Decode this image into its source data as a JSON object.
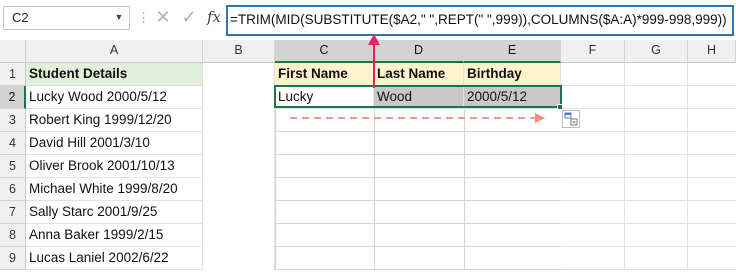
{
  "formula_bar": {
    "name_box": "C2",
    "cancel_icon": "✕",
    "enter_icon": "✓",
    "fx_label": "fx",
    "formula": "=TRIM(MID(SUBSTITUTE($A2,\" \",REPT(\" \",999)),COLUMNS($A:A)*999-998,999))"
  },
  "columns": [
    "A",
    "B",
    "C",
    "D",
    "E",
    "F",
    "G",
    "H"
  ],
  "rows": [
    "1",
    "2",
    "3",
    "4",
    "5",
    "6",
    "7",
    "8",
    "9"
  ],
  "column_a": [
    "Student Details",
    "Lucky Wood 2000/5/12",
    "Robert King 1999/12/20",
    "David Hill 2001/3/10",
    "Oliver Brook 2001/10/13",
    "Michael White 1999/8/20",
    "Sally Starc 2001/9/25",
    "Anna Baker 1999/2/15",
    "Lucas Laniel 2002/6/22"
  ],
  "table_headers": [
    "First Name",
    "Last Name",
    "Birthday"
  ],
  "row2_values": [
    "Lucky",
    "Wood",
    "2000/5/12"
  ],
  "colors": {
    "selection_green": "#217346",
    "header_fill": "#e2efda",
    "table_header_fill": "#fff2cc",
    "annotation_red": "#e0245e",
    "fill_arrow": "#f08c7a"
  }
}
